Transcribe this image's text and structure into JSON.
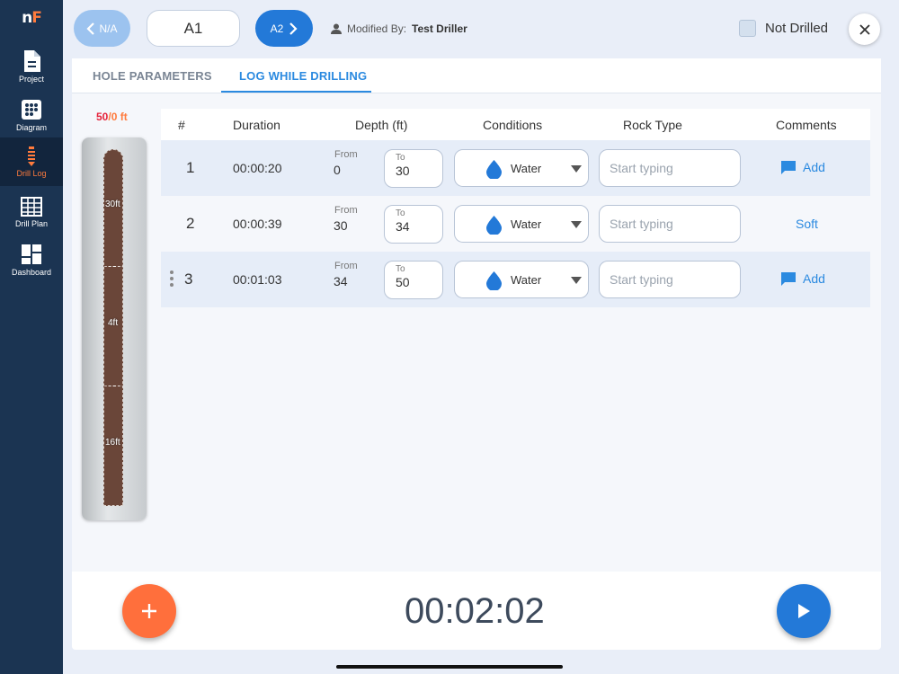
{
  "brand": {
    "logo_n": "n",
    "logo_f": "F"
  },
  "sidebar": {
    "items": [
      {
        "label": "Project",
        "icon": "document-icon"
      },
      {
        "label": "Diagram",
        "icon": "grid-dots-icon"
      },
      {
        "label": "Drill Log",
        "icon": "drill-icon",
        "active": true
      },
      {
        "label": "Drill Plan",
        "icon": "table-grid-icon"
      },
      {
        "label": "Dashboard",
        "icon": "dashboard-icon"
      }
    ]
  },
  "header": {
    "prev_label": "N/A",
    "current_hole": "A1",
    "next_label": "A2",
    "modified_prefix": "Modified By:",
    "modified_by": "Test Driller",
    "not_drilled_label": "Not Drilled"
  },
  "tabs": [
    "HOLE PARAMETERS",
    "LOG WHILE DRILLING"
  ],
  "active_tab": "LOG WHILE DRILLING",
  "gauge": {
    "count_red": "50",
    "count_orange": "/0 ft",
    "segments": [
      "30ft",
      "4ft",
      "16ft"
    ]
  },
  "table": {
    "headers": [
      "#",
      "Duration",
      "Depth (ft)",
      "Conditions",
      "Rock Type",
      "Comments"
    ],
    "from_label": "From",
    "to_label": "To",
    "rock_placeholder": "Start typing",
    "rows": [
      {
        "num": "1",
        "duration": "00:00:20",
        "from": "0",
        "to": "30",
        "condition": "Water",
        "comment": "Add",
        "comment_type": "button"
      },
      {
        "num": "2",
        "duration": "00:00:39",
        "from": "30",
        "to": "34",
        "condition": "Water",
        "comment": "Soft",
        "comment_type": "text"
      },
      {
        "num": "3",
        "duration": "00:01:03",
        "from": "34",
        "to": "50",
        "condition": "Water",
        "comment": "Add",
        "comment_type": "button"
      }
    ]
  },
  "footer": {
    "timer": "00:02:02",
    "add_icon": "plus-icon",
    "play_icon": "play-icon"
  },
  "colors": {
    "accent": "#2379d8",
    "orange": "#ff6f3c",
    "sidebar": "#1b3452",
    "red": "#e5233b"
  }
}
